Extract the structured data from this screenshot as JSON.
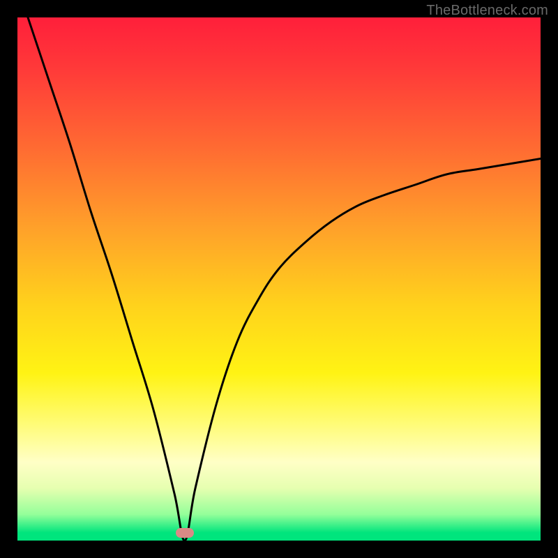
{
  "watermark": "TheBottleneck.com",
  "colors": {
    "marker": "#d98a86",
    "curve": "#000000",
    "gradient_stops": [
      {
        "offset": 0.0,
        "color": "#ff1f3a"
      },
      {
        "offset": 0.1,
        "color": "#ff3a39"
      },
      {
        "offset": 0.25,
        "color": "#ff6b32"
      },
      {
        "offset": 0.4,
        "color": "#ffa02a"
      },
      {
        "offset": 0.55,
        "color": "#ffd21c"
      },
      {
        "offset": 0.68,
        "color": "#fff314"
      },
      {
        "offset": 0.78,
        "color": "#fffc7a"
      },
      {
        "offset": 0.85,
        "color": "#ffffc6"
      },
      {
        "offset": 0.9,
        "color": "#e6ffb0"
      },
      {
        "offset": 0.95,
        "color": "#94ff9a"
      },
      {
        "offset": 0.985,
        "color": "#00e57d"
      },
      {
        "offset": 1.0,
        "color": "#00e57d"
      }
    ]
  },
  "chart_data": {
    "type": "line",
    "title": "",
    "xlabel": "",
    "ylabel": "",
    "xlim": [
      0,
      100
    ],
    "ylim": [
      0,
      100
    ],
    "x_min_point": 32,
    "series": [
      {
        "name": "bottleneck-curve",
        "x": [
          2,
          6,
          10,
          14,
          18,
          22,
          26,
          30,
          32,
          34,
          38,
          42,
          46,
          50,
          55,
          60,
          65,
          70,
          76,
          82,
          88,
          94,
          100
        ],
        "values": [
          100,
          88,
          76,
          63,
          51,
          38,
          25,
          9,
          0,
          10,
          26,
          38,
          46,
          52,
          57,
          61,
          64,
          66,
          68,
          70,
          71,
          72,
          73
        ]
      }
    ],
    "marker": {
      "x": 32,
      "y": 1.5
    }
  }
}
